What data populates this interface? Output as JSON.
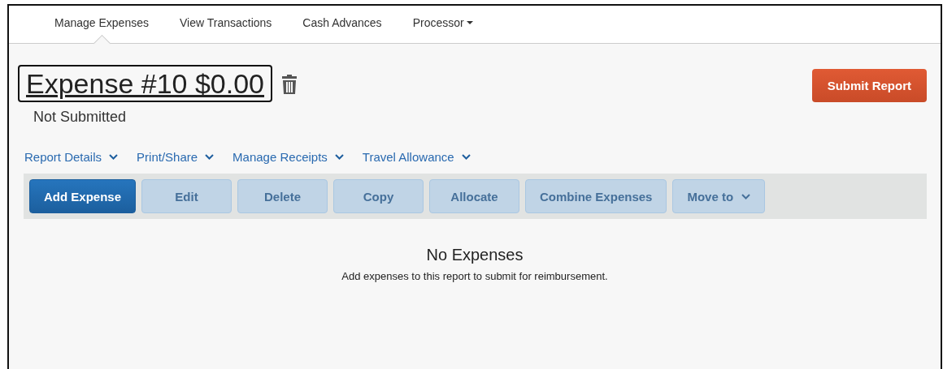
{
  "tabs": [
    {
      "label": "Manage Expenses",
      "selected": true,
      "dropdown": false
    },
    {
      "label": "View Transactions",
      "selected": false,
      "dropdown": false
    },
    {
      "label": "Cash Advances",
      "selected": false,
      "dropdown": false
    },
    {
      "label": "Processor",
      "selected": false,
      "dropdown": true
    }
  ],
  "report": {
    "title": "Expense #10 $0.00",
    "status": "Not Submitted",
    "submit_button": "Submit Report"
  },
  "menus": [
    "Report Details",
    "Print/Share",
    "Manage Receipts",
    "Travel Allowance"
  ],
  "toolbar": [
    {
      "label": "Add Expense",
      "disabled": false,
      "dropdown": false
    },
    {
      "label": "Edit",
      "disabled": true,
      "dropdown": false
    },
    {
      "label": "Delete",
      "disabled": true,
      "dropdown": false
    },
    {
      "label": "Copy",
      "disabled": true,
      "dropdown": false
    },
    {
      "label": "Allocate",
      "disabled": true,
      "dropdown": false
    },
    {
      "label": "Combine Expenses",
      "disabled": true,
      "dropdown": false
    },
    {
      "label": "Move to",
      "disabled": true,
      "dropdown": true
    }
  ],
  "empty_state": {
    "title": "No Expenses",
    "message": "Add expenses to this report to submit for reimbursement."
  }
}
